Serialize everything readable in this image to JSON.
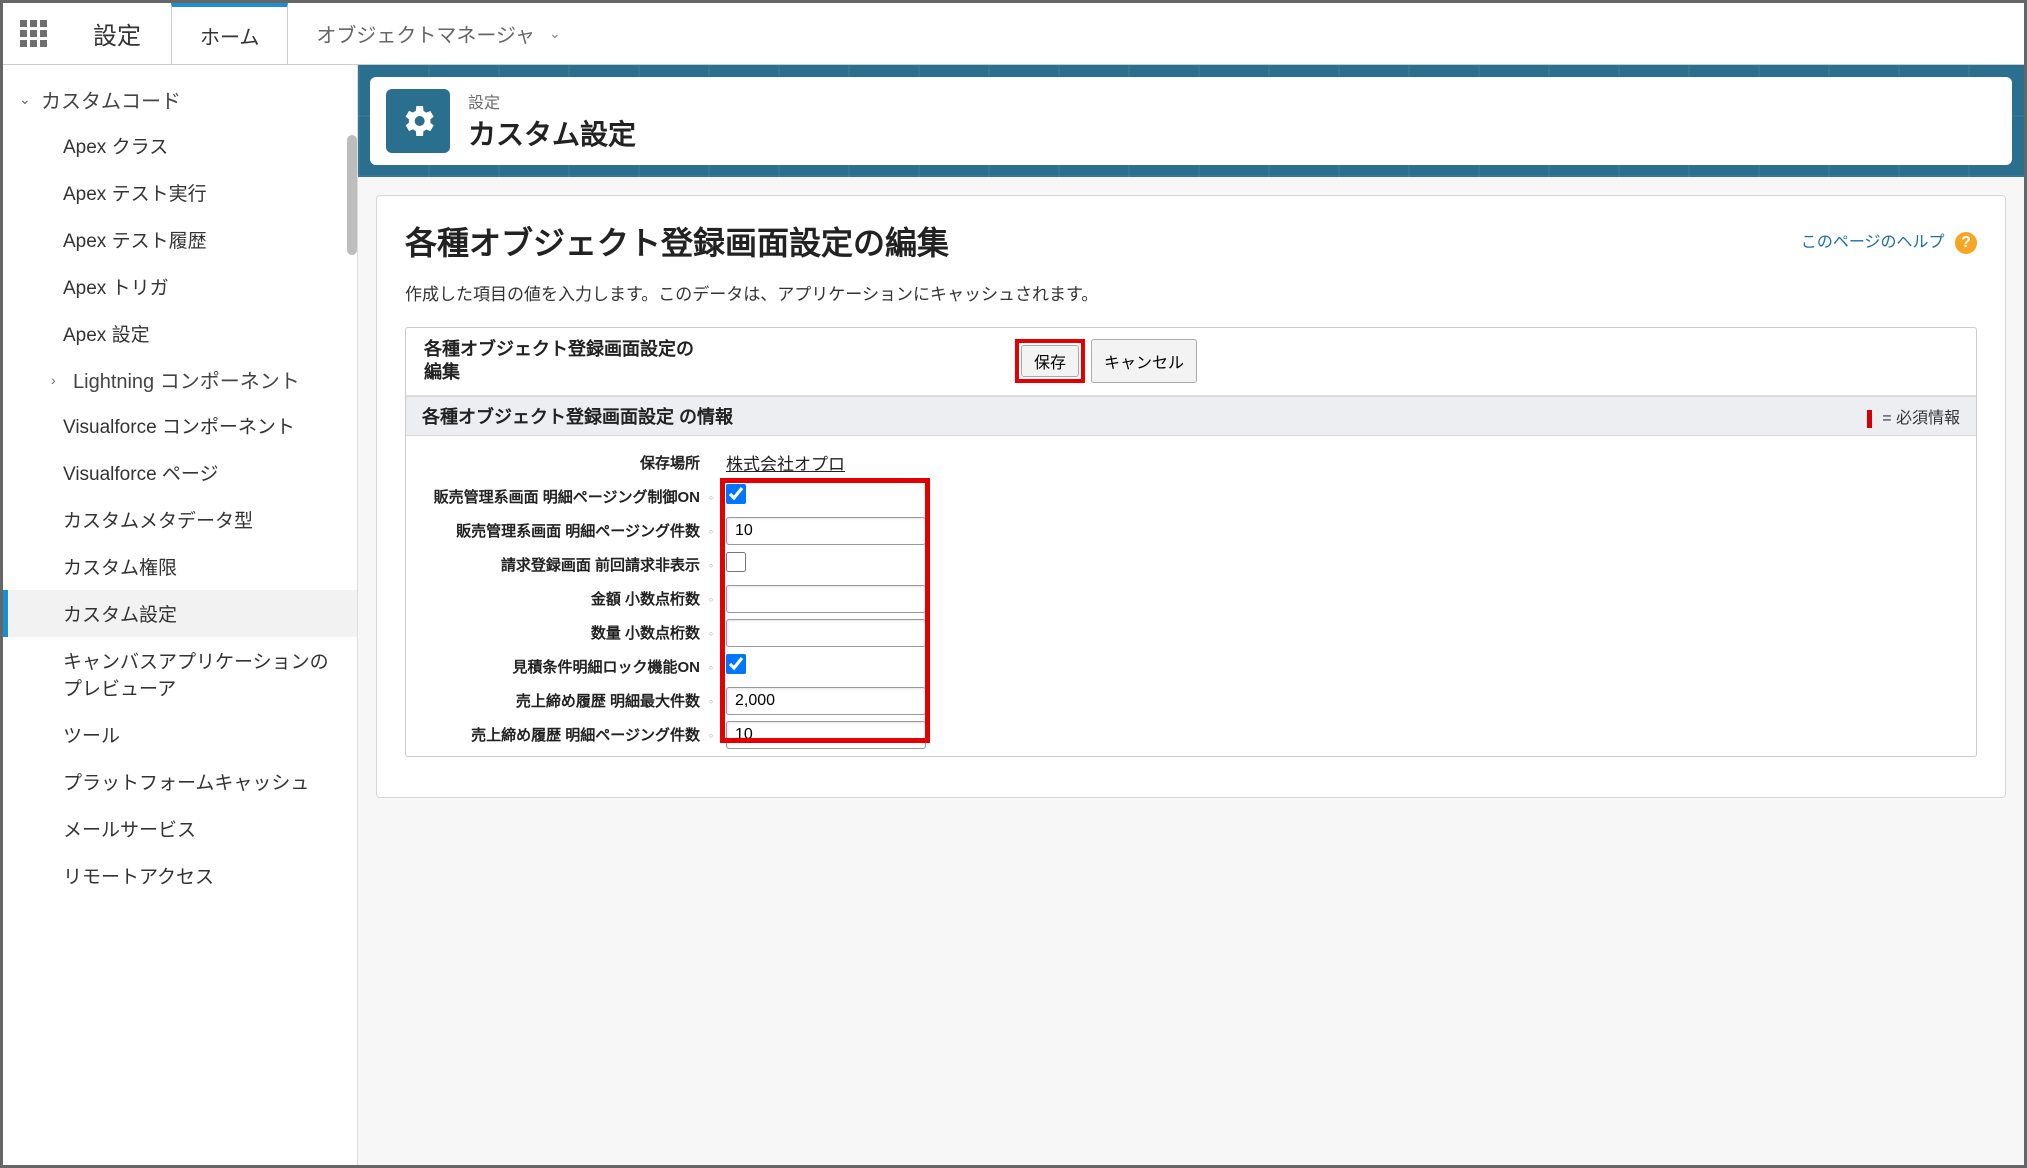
{
  "global": {
    "waffle": "apps",
    "title": "設定"
  },
  "tabs": [
    {
      "label": "ホーム"
    },
    {
      "label": "オブジェクトマネージャ"
    }
  ],
  "sidebar": {
    "group": "カスタムコード",
    "subgroup": "Lightning コンポーネント",
    "items": [
      "Apex クラス",
      "Apex テスト実行",
      "Apex テスト履歴",
      "Apex トリガ",
      "Apex 設定",
      "Visualforce コンポーネント",
      "Visualforce ページ",
      "カスタムメタデータ型",
      "カスタム権限",
      "カスタム設定",
      "キャンバスアプリケーションのプレビューア",
      "ツール",
      "プラットフォームキャッシュ",
      "メールサービス",
      "リモートアクセス"
    ]
  },
  "header": {
    "breadcrumb": "設定",
    "title": "カスタム設定"
  },
  "page": {
    "heading": "各種オブジェクト登録画面設定の編集",
    "helpLink": "このページのヘルプ",
    "description": "作成した項目の値を入力します。このデータは、アプリケーションにキャッシュされます。",
    "blockTitle": "各種オブジェクト登録画面設定の編集",
    "saveBtn": "保存",
    "cancelBtn": "キャンセル",
    "sectionTitle": "各種オブジェクト登録画面設定 の情報",
    "requiredLegend": "= 必須情報"
  },
  "form": {
    "locationLabel": "保存場所",
    "locationValue": "株式会社オプロ",
    "pagingOnLabel": "販売管理系画面 明細ページング制御ON",
    "pagingCountLabel": "販売管理系画面 明細ページング件数",
    "pagingCountValue": "10",
    "hidePrevBillingLabel": "請求登録画面 前回請求非表示",
    "amountDecLabel": "金額 小数点桁数",
    "amountDecValue": "",
    "qtyDecLabel": "数量 小数点桁数",
    "qtyDecValue": "",
    "lockOnLabel": "見積条件明細ロック機能ON",
    "salesMaxLabel": "売上締め履歴 明細最大件数",
    "salesMaxValue": "2,000",
    "salesPagingLabel": "売上締め履歴 明細ページング件数",
    "salesPagingValue": "10"
  }
}
